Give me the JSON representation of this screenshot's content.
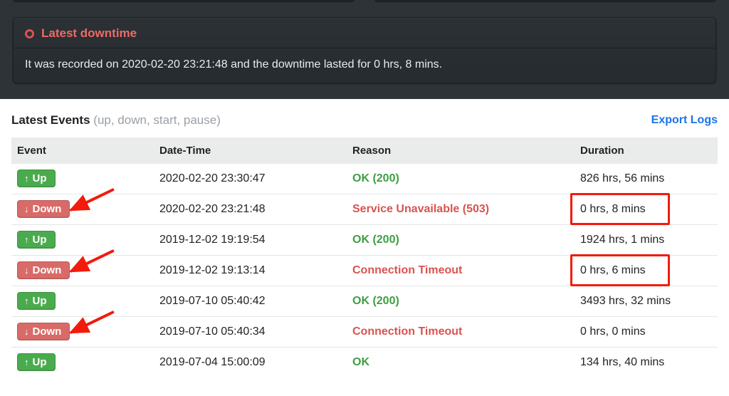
{
  "downtime_card": {
    "title": "Latest downtime",
    "message": "It was recorded on 2020-02-20 23:21:48 and the downtime lasted for 0 hrs, 8 mins."
  },
  "events_section": {
    "heading": "Latest Events",
    "hint": "(up, down, start, pause)",
    "export_label": "Export Logs"
  },
  "headers": {
    "event": "Event",
    "datetime": "Date-Time",
    "reason": "Reason",
    "duration": "Duration"
  },
  "badge_labels": {
    "up": "Up",
    "down": "Down"
  },
  "rows": [
    {
      "status": "up",
      "datetime": "2020-02-20 23:30:47",
      "reason": "OK (200)",
      "reason_kind": "ok",
      "duration": "826 hrs, 56 mins"
    },
    {
      "status": "down",
      "datetime": "2020-02-20 23:21:48",
      "reason": "Service Unavailable (503)",
      "reason_kind": "err",
      "duration": "0 hrs, 8 mins"
    },
    {
      "status": "up",
      "datetime": "2019-12-02 19:19:54",
      "reason": "OK (200)",
      "reason_kind": "ok",
      "duration": "1924 hrs, 1 mins"
    },
    {
      "status": "down",
      "datetime": "2019-12-02 19:13:14",
      "reason": "Connection Timeout",
      "reason_kind": "err",
      "duration": "0 hrs, 6 mins"
    },
    {
      "status": "up",
      "datetime": "2019-07-10 05:40:42",
      "reason": "OK (200)",
      "reason_kind": "ok",
      "duration": "3493 hrs, 32 mins"
    },
    {
      "status": "down",
      "datetime": "2019-07-10 05:40:34",
      "reason": "Connection Timeout",
      "reason_kind": "err",
      "duration": "0 hrs, 0 mins"
    },
    {
      "status": "up",
      "datetime": "2019-07-04 15:00:09",
      "reason": "OK",
      "reason_kind": "ok",
      "duration": "134 hrs, 40 mins"
    }
  ],
  "annotations": {
    "highlight_rows": [
      1,
      3
    ],
    "arrow_rows": [
      1,
      3,
      5
    ]
  }
}
